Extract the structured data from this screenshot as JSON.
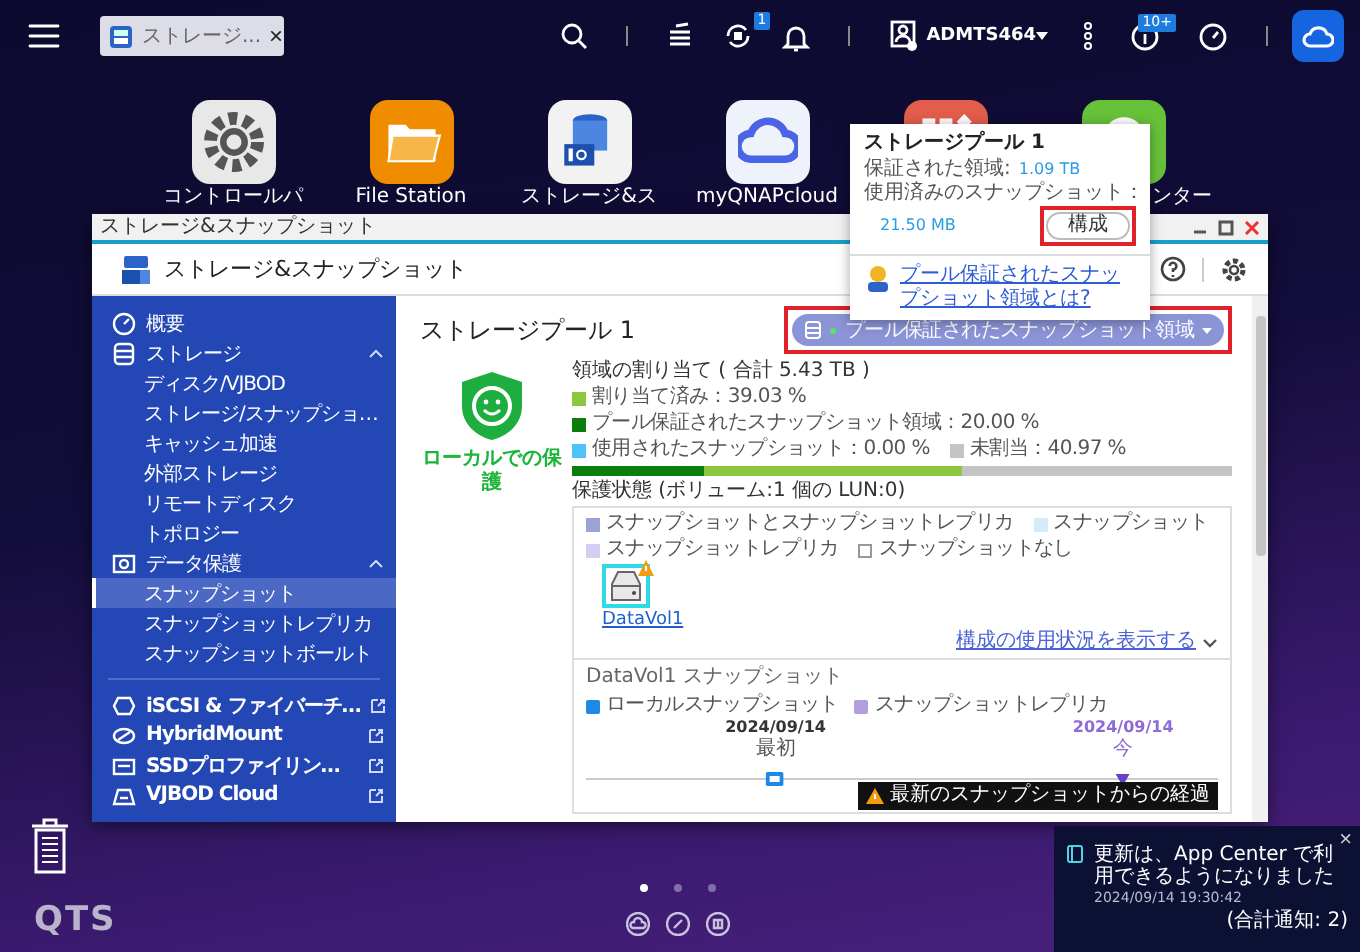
{
  "taskbar": {
    "tab": {
      "label": "ストレージ...",
      "close": "×"
    },
    "sync_badge": "1",
    "user": "ADMTS464",
    "info_badge": "10+"
  },
  "desktop_icons": [
    {
      "kind": "settings",
      "label": "コントロールパ"
    },
    {
      "kind": "folder",
      "label": "File Station"
    },
    {
      "kind": "storage",
      "label": "ストレージ&ス"
    },
    {
      "kind": "cloud",
      "label": "myQNAPcloud"
    },
    {
      "kind": "apps"
    },
    {
      "kind": "help",
      "label": "ンター"
    }
  ],
  "window": {
    "title": "ストレージ&スナップショット",
    "app_title": "ストレージ&スナップショット"
  },
  "sidebar": {
    "items": [
      {
        "kind": "overview",
        "label": "概要",
        "selected": false
      },
      {
        "kind": "storage",
        "label": "ストレージ",
        "selected": false,
        "expanded": true,
        "children": [
          {
            "label": "ディスク/VJBOD",
            "selected": false
          },
          {
            "label": "ストレージ/スナップショ…",
            "selected": false
          },
          {
            "label": "キャッシュ加速",
            "selected": false
          },
          {
            "label": "外部ストレージ",
            "selected": false
          },
          {
            "label": "リモートディスク",
            "selected": false
          },
          {
            "label": "トポロジー",
            "selected": false
          }
        ]
      },
      {
        "kind": "protection",
        "label": "データ保護",
        "selected": false,
        "expanded": true,
        "children": [
          {
            "label": "スナップショット",
            "selected": true
          },
          {
            "label": "スナップショットレプリカ",
            "selected": false
          },
          {
            "label": "スナップショットボールト",
            "selected": false
          }
        ]
      }
    ],
    "external": [
      {
        "kind": "iscsi",
        "label": "iSCSI & ファイバーチ…"
      },
      {
        "kind": "hybridmount",
        "label": "HybridMount"
      },
      {
        "kind": "ssd",
        "label": "SSDプロファイリン…"
      },
      {
        "kind": "vjbod",
        "label": "VJBOD Cloud"
      }
    ]
  },
  "main": {
    "title": "ストレージプール 1",
    "pill": "プール保証されたスナップショット領域",
    "status": "ローカルでの保護",
    "allocation": {
      "heading": "領域の割り当て ( 合計 5.43 TB )",
      "legend": [
        {
          "label": "割り当て済み：39.03 %",
          "color": "#8dc63f"
        },
        {
          "label": "プール保証されたスナップショット領域：20.00 %",
          "color": "#0b7d0b"
        },
        {
          "label": "使用されたスナップショット：0.00 %",
          "color": "#4fc3f7"
        },
        {
          "label": "未割当：40.97 %",
          "color": "#c4c4c4"
        }
      ],
      "bar": [
        {
          "color": "#0b7d0b",
          "level": 0.2
        },
        {
          "color": "#8dc63f",
          "level": 0.3903
        }
      ]
    },
    "protection": {
      "heading": "保護状態 (ボリューム:1 個の LUN:0)",
      "legend": [
        {
          "label": "スナップショットとスナップショットレプリカ",
          "color": "#9aa3d4"
        },
        {
          "label": "スナップショット",
          "color": "#d5ebf7"
        },
        {
          "label": "スナップショットレプリカ",
          "color": "#d2cff2"
        },
        {
          "label": "スナップショットなし",
          "color": "#ffffff"
        }
      ],
      "volume": {
        "label": "DataVol1",
        "warning": true
      },
      "link": "構成の使用状況を表示する"
    },
    "snapshots": {
      "title": "DataVol1 スナップショット",
      "legend": [
        {
          "label": "ローカルスナップショット",
          "color": "#1e88e5"
        },
        {
          "label": "スナップショットレプリカ",
          "color": "#b39ddb"
        }
      ],
      "markers": [
        {
          "kind": "local",
          "date": "2024/09/14",
          "caption": "最初"
        },
        {
          "kind": "replica",
          "date": "2024/09/14",
          "caption": "今"
        }
      ],
      "tooltip": "最新のスナップショットからの経過"
    }
  },
  "popup": {
    "title": "ストレージプール 1",
    "rows": [
      {
        "label": "保証された領域:",
        "value": "1.09 TB"
      },
      {
        "label": "使用済みのスナップショット：",
        "value": "21.50 MB"
      }
    ],
    "button": "構成",
    "link": "プール保証されたスナップショット領域とは?"
  },
  "footer": {
    "logo": "QTS",
    "pages": [
      {
        "selected": true
      },
      {
        "selected": false
      },
      {
        "selected": false
      }
    ]
  },
  "toast": {
    "message": "更新は、App Center で利用できるようになりました",
    "time": "2024/09/14 19:30:42",
    "total": "(合計通知: 2)",
    "close": "×"
  }
}
